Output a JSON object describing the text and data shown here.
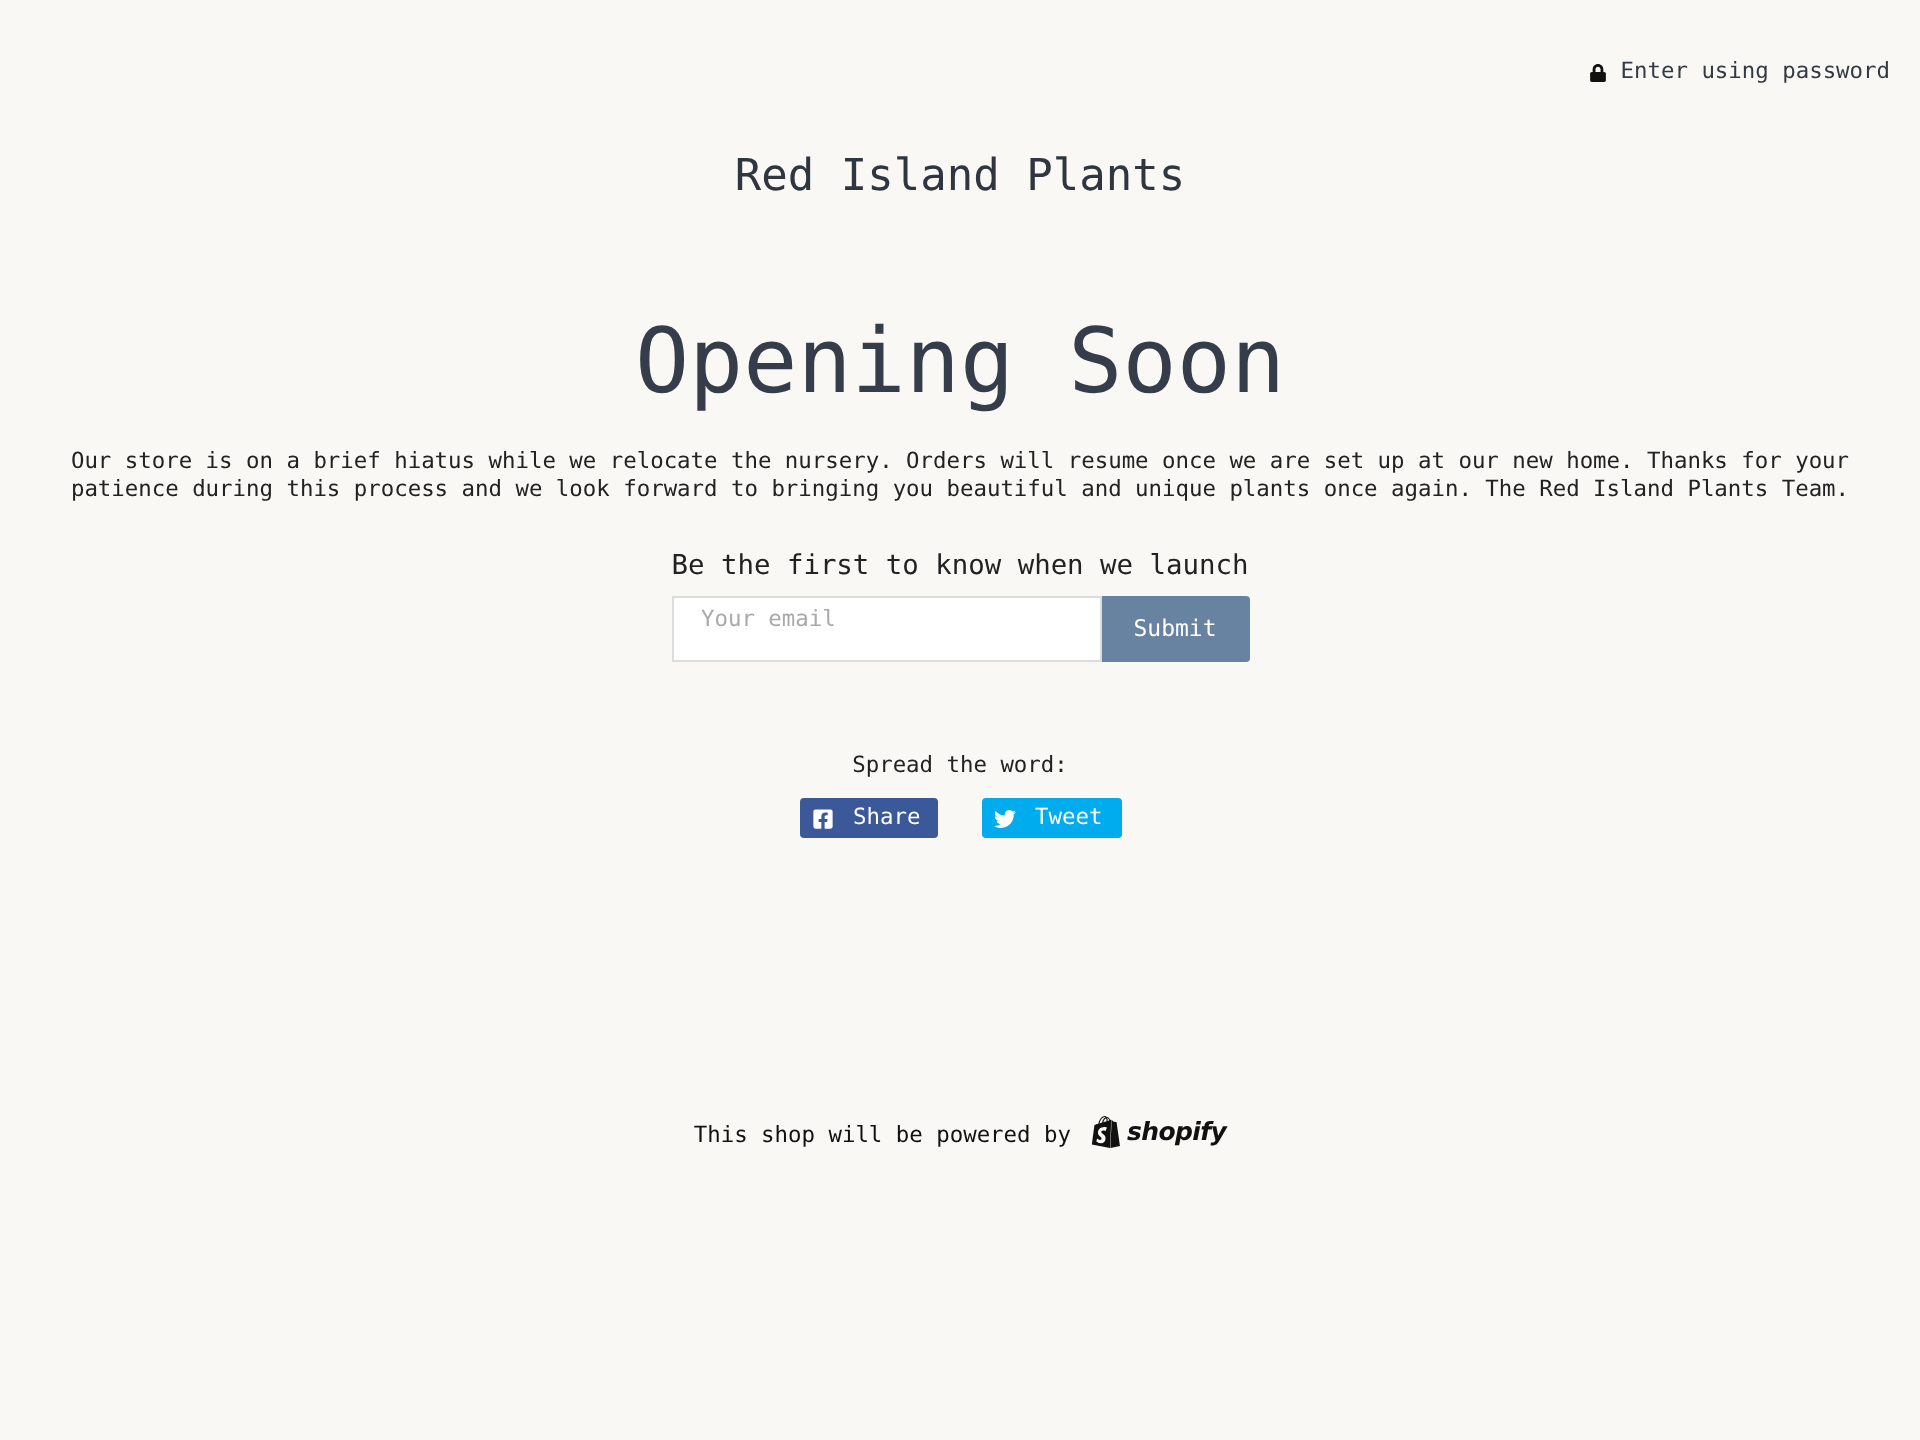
{
  "header": {
    "password_link": "Enter using password"
  },
  "store_name": "Red Island Plants",
  "headline": "Opening Soon",
  "message": "Our store is on a brief hiatus while we relocate the nursery. Orders will resume once we are set up at our new home. Thanks for your patience during this process and we look forward to bringing you beautiful and unique plants once again. The Red Island Plants Team.",
  "signup": {
    "heading": "Be the first to know when we launch",
    "email": {
      "placeholder": "Your email"
    },
    "submit": "Submit"
  },
  "share": {
    "label": "Spread the word:",
    "buttons": [
      {
        "kind": "facebook",
        "label": "Share"
      },
      {
        "kind": "twitter",
        "label": "Tweet"
      }
    ]
  },
  "footer": {
    "text": "This shop will be powered by",
    "logo": "shopify"
  }
}
